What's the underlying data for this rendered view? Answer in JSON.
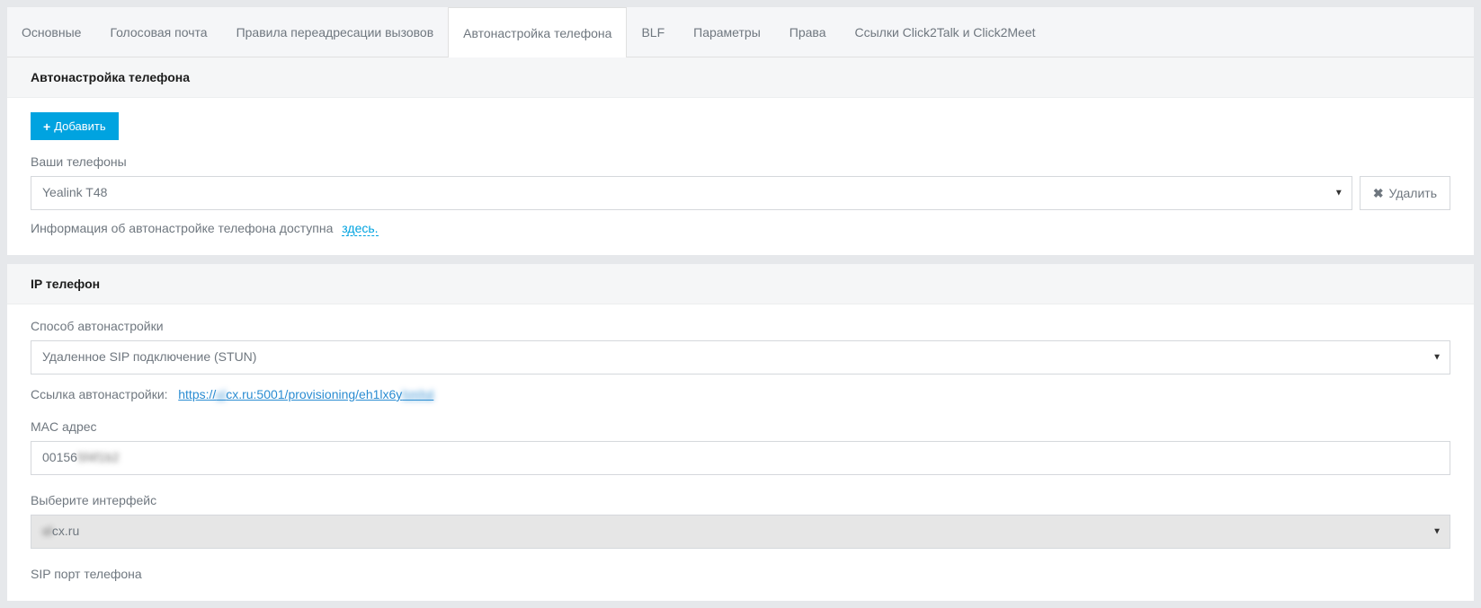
{
  "tabs": {
    "main": "Основные",
    "voicemail": "Голосовая почта",
    "forwarding": "Правила переадресации вызовов",
    "autoconfig": "Автонастройка телефона",
    "blf": "BLF",
    "params": "Параметры",
    "rights": "Права",
    "links": "Ссылки Click2Talk и Click2Meet"
  },
  "section1": {
    "heading": "Автонастройка телефона",
    "addLabel": "Добавить",
    "yourPhonesLabel": "Ваши телефоны",
    "phoneSelectValue": "Yealink T48",
    "deleteLabel": "Удалить",
    "infoText": "Информация об автонастройке телефона доступна",
    "infoLink": "здесь."
  },
  "section2": {
    "heading": "IP телефон",
    "methodLabel": "Способ автонастройки",
    "methodValue": "Удаленное SIP подключение (STUN)",
    "provLabel": "Ссылка автонастройки:",
    "provLinkPrefix": "https://",
    "provLinkBlur1": "ol",
    "provLinkMid": "cx.ru:5001/provisioning/eh1lx6y",
    "provLinkBlur2": "hmhd",
    "macLabel": "MAC адрес",
    "macValuePrefix": "00156",
    "macValueBlur": "5f4f1b2",
    "ifaceLabel": "Выберите интерфейс",
    "ifaceValueBlur": "ol",
    "ifaceValueVisible": "cx.ru",
    "sipPortLabel": "SIP порт телефона"
  }
}
